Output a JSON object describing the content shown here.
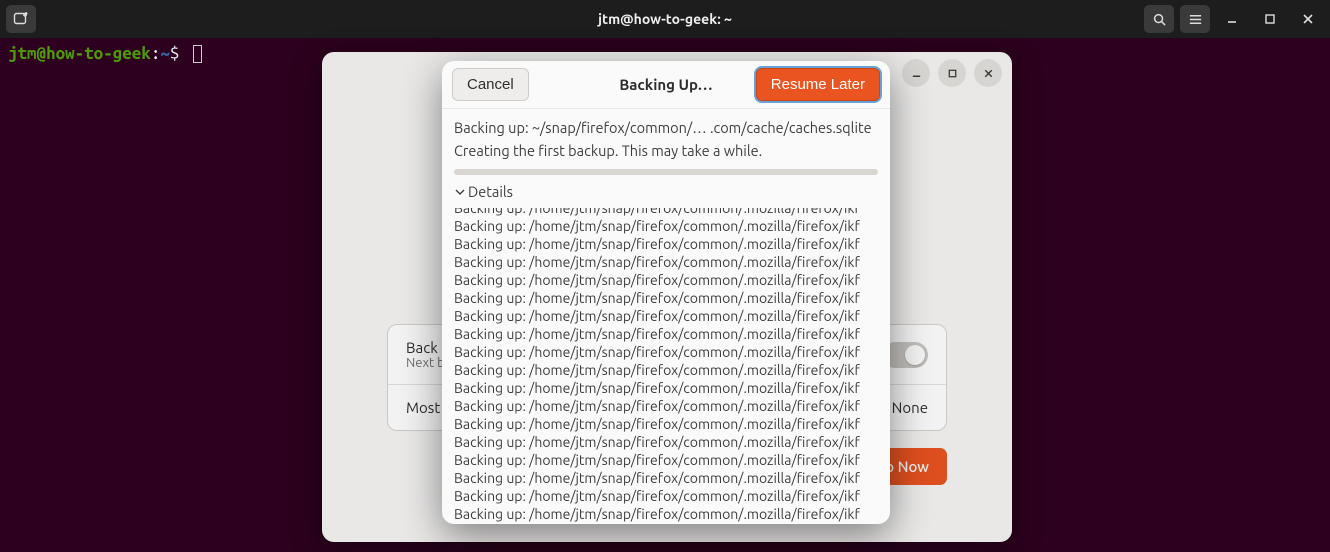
{
  "titlebar": {
    "title": "jtm@how-to-geek: ~"
  },
  "prompt": {
    "userhost": "jtm@how-to-geek",
    "sep": ":",
    "path": "~",
    "symbol": "$"
  },
  "deja": {
    "backup_auto_title": "Back Up",
    "backup_auto_sub": "Next bac",
    "most_recent_label": "Most R",
    "most_recent_value": "None",
    "backup_now_label": "p Now"
  },
  "dialog": {
    "cancel": "Cancel",
    "title": "Backing Up…",
    "resume": "Resume Later",
    "line1": "Backing up: ~/snap/firefox/common/… .com/cache/caches.sqlite",
    "line2": "Creating the first backup.  This may take a while.",
    "details_label": "Details",
    "log": [
      "Backing up: /home/jtm/snap/firefox/common/.mozilla/firefox/ikf",
      "Backing up: /home/jtm/snap/firefox/common/.mozilla/firefox/ikf",
      "Backing up: /home/jtm/snap/firefox/common/.mozilla/firefox/ikf",
      "Backing up: /home/jtm/snap/firefox/common/.mozilla/firefox/ikf",
      "Backing up: /home/jtm/snap/firefox/common/.mozilla/firefox/ikf",
      "Backing up: /home/jtm/snap/firefox/common/.mozilla/firefox/ikf",
      "Backing up: /home/jtm/snap/firefox/common/.mozilla/firefox/ikf",
      "Backing up: /home/jtm/snap/firefox/common/.mozilla/firefox/ikf",
      "Backing up: /home/jtm/snap/firefox/common/.mozilla/firefox/ikf",
      "Backing up: /home/jtm/snap/firefox/common/.mozilla/firefox/ikf",
      "Backing up: /home/jtm/snap/firefox/common/.mozilla/firefox/ikf",
      "Backing up: /home/jtm/snap/firefox/common/.mozilla/firefox/ikf",
      "Backing up: /home/jtm/snap/firefox/common/.mozilla/firefox/ikf",
      "Backing up: /home/jtm/snap/firefox/common/.mozilla/firefox/ikf",
      "Backing up: /home/jtm/snap/firefox/common/.mozilla/firefox/ikf",
      "Backing up: /home/jtm/snap/firefox/common/.mozilla/firefox/ikf",
      "Backing up: /home/jtm/snap/firefox/common/.mozilla/firefox/ikf",
      "Backing up: /home/jtm/snap/firefox/common/.mozilla/firefox/ikf"
    ]
  }
}
